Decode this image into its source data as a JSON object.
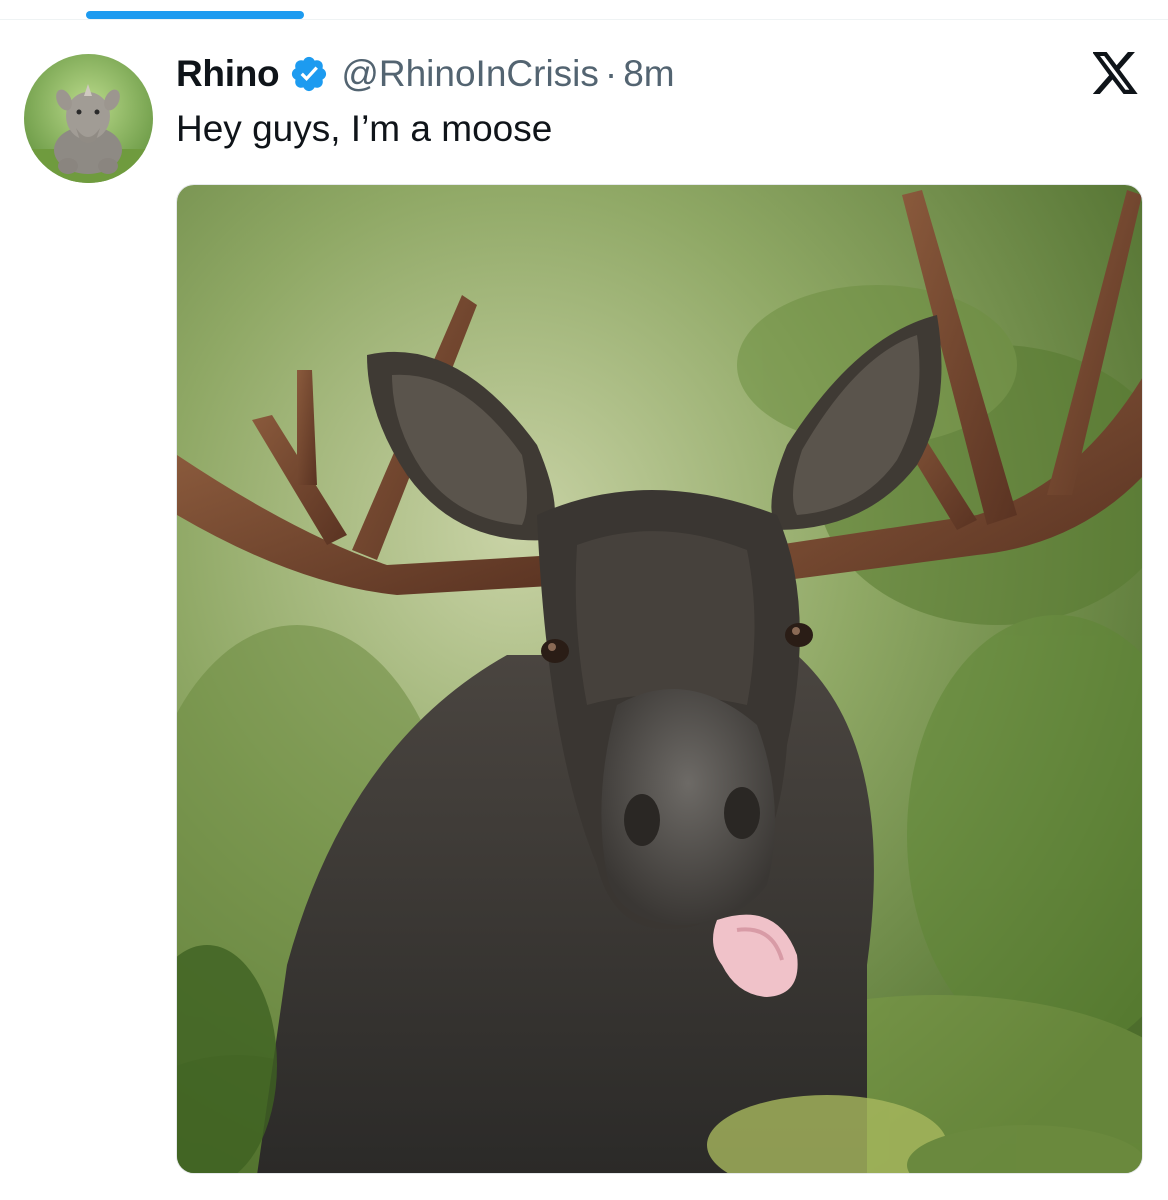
{
  "author": {
    "display_name": "Rhino",
    "handle": "@RhinoInCrisis",
    "separator": "·",
    "timestamp": "8m",
    "verified": true,
    "avatar_icon": "rhino-avatar"
  },
  "tweet": {
    "text": "Hey guys, I’m a moose",
    "media": {
      "icon": "moose-photo",
      "subject": "moose photo"
    }
  },
  "icons": {
    "platform_logo": "x-logo-icon",
    "verified": "verified-badge-icon"
  },
  "colors": {
    "accent": "#1d9bf0",
    "text_primary": "#0f1419",
    "text_secondary": "#536471"
  }
}
